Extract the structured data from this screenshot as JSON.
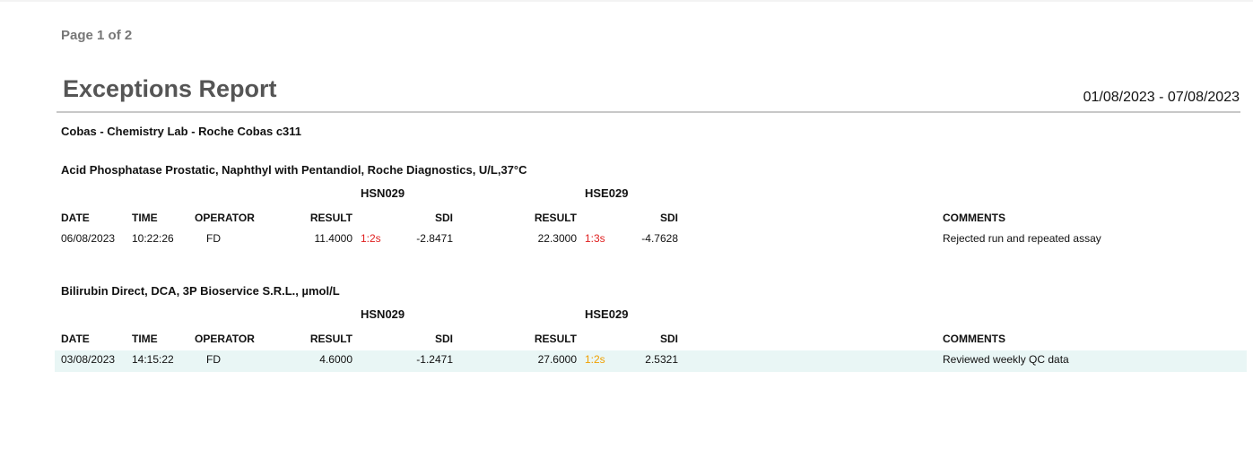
{
  "page_label": "Page 1 of 2",
  "report_title": "Exceptions Report",
  "date_range": "01/08/2023 - 07/08/2023",
  "lab_name": "Cobas - Chemistry Lab - Roche Cobas c311",
  "colors": {
    "reject": "#e02020",
    "warn": "#f0a000",
    "row_highlight": "#e9f6f5",
    "title": "#555555"
  },
  "columns": {
    "date": "DATE",
    "time": "TIME",
    "operator": "OPERATOR",
    "result": "RESULT",
    "sdi": "SDI",
    "comments": "COMMENTS"
  },
  "sections": [
    {
      "test": "Acid Phosphatase Prostatic, Naphthyl with Pentandiol, Roche Diagnostics, U/L,37°C",
      "lot1": "HSN029",
      "lot2": "HSE029",
      "row": {
        "date": "06/08/2023",
        "time": "10:22:26",
        "operator": "FD",
        "result1": "11.4000",
        "rule1": "1:2s",
        "sdi1": "-2.8471",
        "result2": "22.3000",
        "rule2": "1:3s",
        "sdi2": "-4.7628",
        "comment": "Rejected run and repeated assay"
      }
    },
    {
      "test": "Bilirubin Direct, DCA, 3P Bioservice S.R.L., µmol/L",
      "lot1": "HSN029",
      "lot2": "HSE029",
      "row": {
        "date": "03/08/2023",
        "time": "14:15:22",
        "operator": "FD",
        "result1": "4.6000",
        "rule1": "",
        "sdi1": "-1.2471",
        "result2": "27.6000",
        "rule2": "1:2s",
        "sdi2": "2.5321",
        "comment": "Reviewed weekly QC data"
      }
    }
  ]
}
